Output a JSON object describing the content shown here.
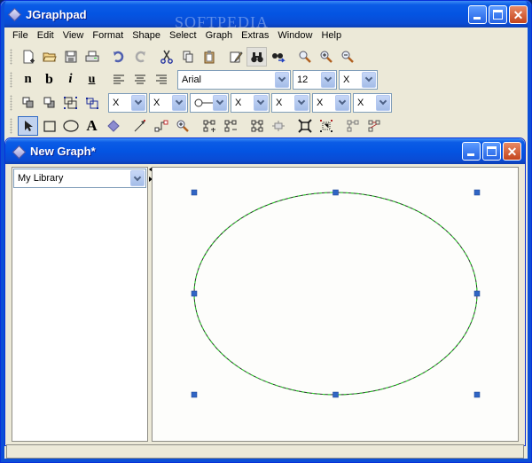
{
  "window": {
    "title": "JGraphpad",
    "minimize": "minimize",
    "maximize": "maximize",
    "close": "close"
  },
  "watermark": "SOFTPEDIA",
  "menubar": [
    "File",
    "Edit",
    "View",
    "Format",
    "Shape",
    "Select",
    "Graph",
    "Extras",
    "Window",
    "Help"
  ],
  "toolbar1": {
    "icons": [
      "new-document-icon",
      "open-folder-icon",
      "save-icon",
      "print-icon",
      "undo-icon",
      "redo-icon",
      "cut-icon",
      "copy-icon",
      "paste-icon",
      "edit-icon",
      "find-icon",
      "find-replace-icon",
      "zoom-icon",
      "zoom-in-icon",
      "zoom-out-icon"
    ]
  },
  "toolbar2": {
    "buttons": [
      {
        "name": "normal-text",
        "label": "n"
      },
      {
        "name": "bold",
        "label": "b"
      },
      {
        "name": "italic",
        "label": "i"
      },
      {
        "name": "underline",
        "label": "u"
      }
    ],
    "align": [
      "align-left-icon",
      "align-center-icon",
      "align-right-icon"
    ],
    "font_family": "Arial",
    "font_size": "12",
    "third_combo": "X"
  },
  "toolbar3": {
    "icons": [
      "to-front-icon",
      "to-back-icon",
      "group-icon",
      "ungroup-icon"
    ],
    "combos": [
      "X",
      "X"
    ],
    "line_end": "o—",
    "combos2": [
      "X",
      "X",
      "X",
      "X"
    ]
  },
  "toolbar4": {
    "tools": [
      "select-tool-icon",
      "rectangle-tool-icon",
      "ellipse-tool-icon",
      "text-tool-icon",
      "diamond-tool-icon",
      "edge-tool-icon",
      "orthogonal-edge-tool-icon",
      "zoom-tool-icon",
      "insert-cell-icon",
      "remove-cell-icon",
      "layout-icon",
      "collapse-icon",
      "expand-icon",
      "fit-icon",
      "route-icon",
      "route-points-icon"
    ],
    "text_tool_label": "A"
  },
  "document": {
    "title": "New Graph*",
    "library_select": "My Library"
  },
  "graph": {
    "shape": "ellipse",
    "stroke_color": "#2b2b2b",
    "highlight_color": "#27e127",
    "handle_color": "#3065c4",
    "selected": true
  }
}
